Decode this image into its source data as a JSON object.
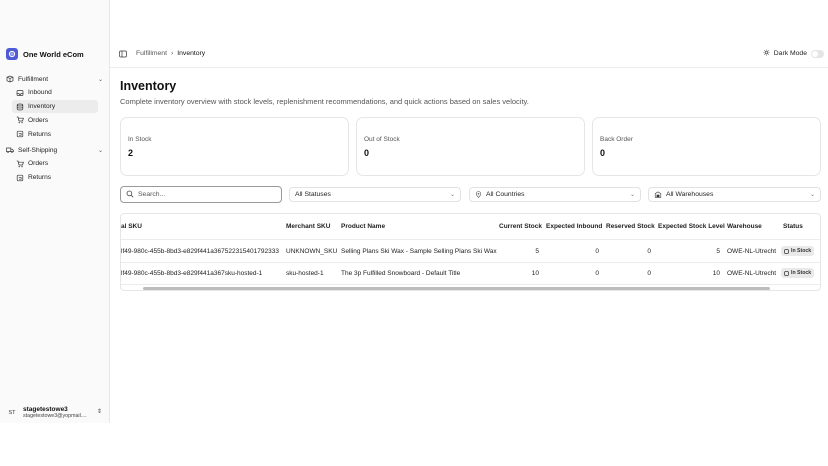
{
  "app": {
    "name": "One World eCom"
  },
  "sidebar": {
    "groups": [
      {
        "label": "Fulfillment",
        "items": [
          {
            "label": "Inbound"
          },
          {
            "label": "Inventory"
          },
          {
            "label": "Orders"
          },
          {
            "label": "Returns"
          }
        ]
      },
      {
        "label": "Self-Shipping",
        "items": [
          {
            "label": "Orders"
          },
          {
            "label": "Returns"
          }
        ]
      }
    ],
    "active_item": "Inventory"
  },
  "user": {
    "initials": "ST",
    "name": "stagetestowe3",
    "email": "stagetestowe3@yopmail...."
  },
  "header": {
    "breadcrumb": [
      "Fulfillment",
      "Inventory"
    ],
    "dark_mode_label": "Dark Mode"
  },
  "page": {
    "title": "Inventory",
    "subtitle": "Complete inventory overview with stock levels, replenishment recommendations, and quick actions based on sales velocity."
  },
  "stats": [
    {
      "label": "In Stock",
      "value": "2"
    },
    {
      "label": "Out of Stock",
      "value": "0"
    },
    {
      "label": "Back Order",
      "value": "0"
    }
  ],
  "filters": {
    "search_placeholder": "Search...",
    "status": "All Statuses",
    "country": "All Countries",
    "warehouse": "All Warehouses"
  },
  "table": {
    "columns": [
      "al SKU",
      "Merchant SKU",
      "Product Name",
      "Current Stock",
      "Expected Inbound",
      "Reserved Stock",
      "Expected Stock Level",
      "Warehouse",
      "Status"
    ],
    "rows": [
      [
        "lf49-980c-455b-8bd3-e829f441a367522315401792333",
        "UNKNOWN_SKU",
        "Selling Plans Ski Wax - Sample Selling Plans Ski Wax",
        "5",
        "0",
        "0",
        "5",
        "OWE-NL-Utrecht",
        "In Stock"
      ],
      [
        "lf49-980c-455b-8bd3-e829f441a367sku-hosted-1",
        "sku-hosted-1",
        "The 3p Fulfilled Snowboard - Default Title",
        "10",
        "0",
        "0",
        "10",
        "OWE-NL-Utrecht",
        "In Stock"
      ]
    ]
  },
  "colors": {
    "brand": "#4f5bd5",
    "badge_bg": "#e9e9e9"
  }
}
